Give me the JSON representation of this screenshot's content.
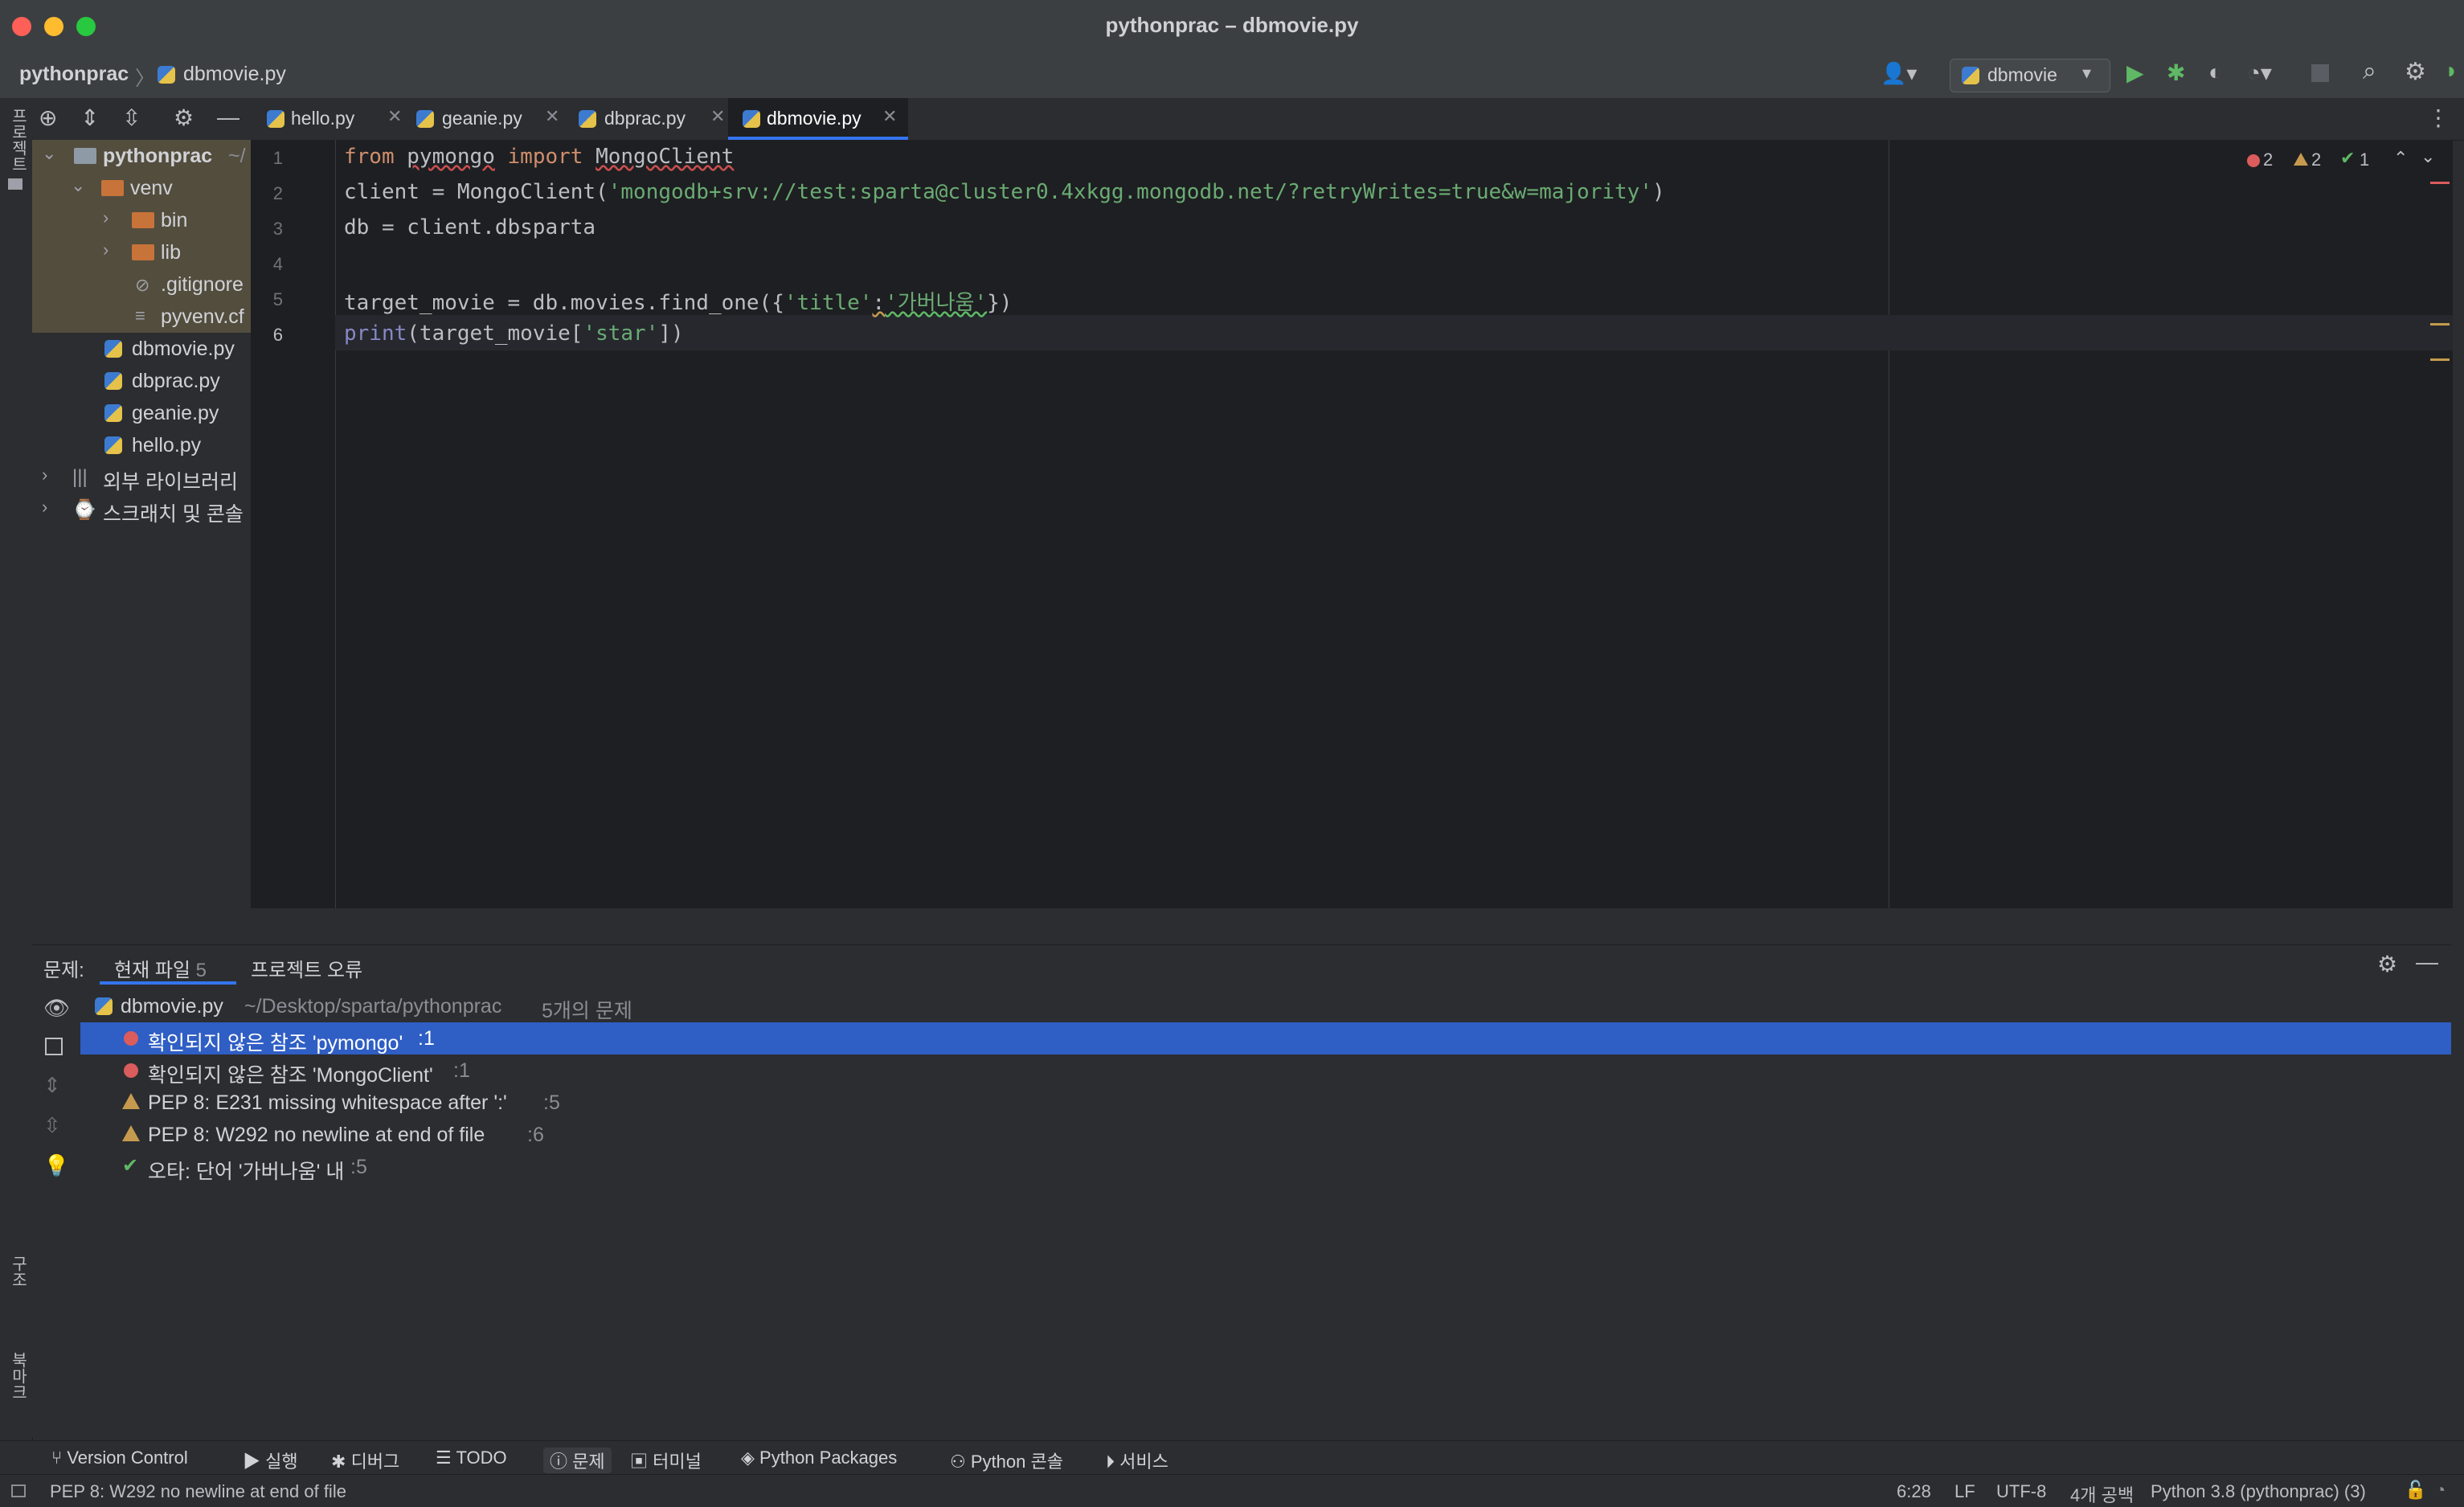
{
  "window": {
    "title": "pythonprac – dbmovie.py"
  },
  "navbar": {
    "project": "pythonprac",
    "file": "dbmovie.py",
    "run_config": "dbmovie"
  },
  "left_stripe": {
    "project_label": "프로젝트",
    "structure_label": "구조",
    "bookmarks_label": "북마크"
  },
  "project_tree": [
    {
      "label": "pythonprac",
      "suffix": "~/",
      "indent": 0,
      "type": "root"
    },
    {
      "label": "venv",
      "indent": 1,
      "type": "folder-open"
    },
    {
      "label": "bin",
      "indent": 2,
      "type": "folder"
    },
    {
      "label": "lib",
      "indent": 2,
      "type": "folder"
    },
    {
      "label": ".gitignore",
      "indent": 3,
      "type": "file"
    },
    {
      "label": "pyvenv.cf",
      "indent": 3,
      "type": "file"
    },
    {
      "label": "dbmovie.py",
      "indent": 2,
      "type": "py"
    },
    {
      "label": "dbprac.py",
      "indent": 2,
      "type": "py"
    },
    {
      "label": "geanie.py",
      "indent": 2,
      "type": "py"
    },
    {
      "label": "hello.py",
      "indent": 2,
      "type": "py"
    },
    {
      "label": "외부 라이브러리",
      "indent": 0,
      "type": "lib"
    },
    {
      "label": "스크래치 및 콘솔",
      "indent": 0,
      "type": "scratch"
    }
  ],
  "tabs": [
    {
      "label": "hello.py"
    },
    {
      "label": "geanie.py"
    },
    {
      "label": "dbprac.py"
    },
    {
      "label": "dbmovie.py",
      "active": true
    }
  ],
  "editor": {
    "line_numbers": [
      "1",
      "2",
      "3",
      "4",
      "5",
      "6"
    ],
    "lines": {
      "l1_kw1": "from",
      "l1_mod": "pymongo",
      "l1_kw2": "import",
      "l1_cls": "MongoClient",
      "l2_a": "client = MongoClient(",
      "l2_str": "'mongodb+srv://test:sparta@cluster0.4xkgg.mongodb.net/?retryWrites=true&w=majority'",
      "l2_b": ")",
      "l3": "db = client.dbsparta",
      "l5_a": "target_movie = db.movies.find_one({",
      "l5_s1": "'title'",
      "l5_colon": ":",
      "l5_s2": "'가버나움'",
      "l5_b": "})",
      "l6_fn": "print",
      "l6_a": "(target_movie[",
      "l6_s": "'star'",
      "l6_b": "])"
    },
    "inspections": {
      "errors": "2",
      "warnings": "2",
      "typos": "1"
    }
  },
  "problems": {
    "label": "문제:",
    "tab_current": "현재 파일",
    "tab_current_count": "5",
    "tab_project": "프로젝트 오류",
    "file": "dbmovie.py",
    "path": "~/Desktop/sparta/pythonprac",
    "count_text": "5개의 문제",
    "items": [
      {
        "text": "확인되지 않은 참조 'pymongo'",
        "loc": ":1",
        "kind": "error"
      },
      {
        "text": "확인되지 않은 참조 'MongoClient'",
        "loc": ":1",
        "kind": "error"
      },
      {
        "text": "PEP 8: E231 missing whitespace after ':'",
        "loc": ":5",
        "kind": "warning"
      },
      {
        "text": "PEP 8: W292 no newline at end of file",
        "loc": ":6",
        "kind": "warning"
      },
      {
        "text": "오타: 단어 '가버나움' 내",
        "loc": ":5",
        "kind": "typo"
      }
    ]
  },
  "tool_windows": [
    {
      "label": "Version Control",
      "icon": "branch-icon"
    },
    {
      "label": "실행",
      "icon": "run-icon"
    },
    {
      "label": "디버그",
      "icon": "bug-icon"
    },
    {
      "label": "TODO",
      "icon": "list-icon"
    },
    {
      "label": "문제",
      "icon": "problems-icon"
    },
    {
      "label": "터미널",
      "icon": "terminal-icon"
    },
    {
      "label": "Python Packages",
      "icon": "packages-icon"
    },
    {
      "label": "Python 콘솔",
      "icon": "python-icon"
    },
    {
      "label": "서비스",
      "icon": "services-icon"
    }
  ],
  "status": {
    "message": "PEP 8: W292 no newline at end of file",
    "position": "6:28",
    "line_sep": "LF",
    "encoding": "UTF-8",
    "indent": "4개 공백",
    "interpreter": "Python 3.8 (pythonprac) (3)"
  },
  "colors": {
    "accent": "#2f5ec4",
    "error": "#db5c5c",
    "warning": "#c69a4e",
    "ok": "#5fb865",
    "run": "#5fb865"
  }
}
